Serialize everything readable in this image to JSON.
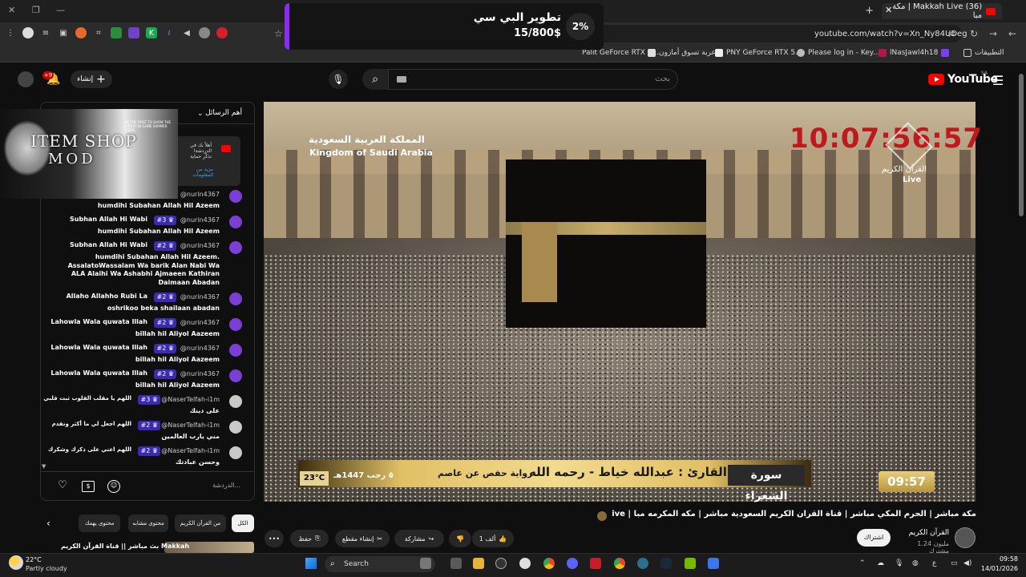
{
  "browser": {
    "tab_title": "(36) ‏Makkah Live | مكة مبا",
    "url": "youtube.com/watch?v=Xn_Ny84UDeg",
    "bookmarks": [
      "Palit GeForce RTX 5...",
      "عربة تسوق أمازون",
      "PNY GeForce RTX 5...",
      "Please log in - Key...",
      "lNasJawl4h18",
      "التطبيقات"
    ]
  },
  "overlay": {
    "percent": "2%",
    "title": "تطوير البي سي",
    "amount": "15/800$"
  },
  "header": {
    "logo_text": "YouTube",
    "country": "SA",
    "search_placeholder": "بحث",
    "create_label": "إنشاء",
    "notif_count": "+9"
  },
  "video": {
    "country_ar": "المملكة العربية السعودية",
    "country_en": "Kingdom of Saudi Arabia",
    "clock": "10:07:56:57",
    "channel_ar": "القرآن الكريم",
    "channel_live": "Live",
    "temp": "23°C",
    "date": "٥ رجب 1447هـ",
    "riwaya": "رواية حفص عن عاصم",
    "qari": "القارئ : عبدالله خياط - رحمه الله",
    "surah": "سورة الشعراء",
    "time": "09:57"
  },
  "details": {
    "title": "مكة مباشر | الحرم المكي مباشر | قناة القران الكريم السعودية مباشر | مكه المكرمه مبا | Makkah Live",
    "channel_name": "القرآن الكريم",
    "channel_subs": "1.24 مليون مشترك",
    "subscribe": "اشتراك",
    "like_count": "1 ألف",
    "share": "مشاركة",
    "clip": "إنشاء مقطع",
    "save": "حفظ",
    "more": "•••"
  },
  "chat": {
    "mode": "أهم الرسائل",
    "pinned_text": "أهلاً بك في الدردشة! تذكّر حماية",
    "pinned_more": "مزيد من المعلومات",
    "input_placeholder": "الدردشة...",
    "overlay_l1": "ITEM SHOP",
    "overlay_l2": "MOD",
    "overlay_small": "BE THE FIRST TO SHOW THE LATEST IN-GAME SUMMER ITEMS",
    "messages": [
      {
        "user": "@nurin4367",
        "badge": "",
        "pre": "",
        "text": "humdihi Subahan Allah Hil Azeem"
      },
      {
        "user": "@nurin4367",
        "badge": "#3",
        "pre": "Subhan Allah Hi Wabi",
        "text": "humdihi Subahan Allah Hil Azeem"
      },
      {
        "user": "@nurin4367",
        "badge": "#2",
        "pre": "Subhan Allah Hi Wabi",
        "text": "humdihi Subahan Allah Hil Azeem. AssalatoWassalam Wa barik Alan Nabi Wa ALA Alaihi Wa Ashabhi Ajmaeen Kathiran Daimaan Abadan"
      },
      {
        "user": "@nurin4367",
        "badge": "#2",
        "pre": "Allaho Allahho Rubi La",
        "text": "oshrikoo beka shailaan abadan"
      },
      {
        "user": "@nurin4367",
        "badge": "#2",
        "pre": "Lahowla Wala quwata Illah",
        "text": "billah hil Aliyol Aazeem"
      },
      {
        "user": "@nurin4367",
        "badge": "#2",
        "pre": "Lahowla Wala quwata Illah",
        "text": "billah hil Aliyol Aazeem"
      },
      {
        "user": "@nurin4367",
        "badge": "#2",
        "pre": "Lahowla Wala quwata Illah",
        "text": "billah hil Aliyol Aazeem"
      },
      {
        "user": "@NaserTelfah-i1m",
        "badge": "#3",
        "pre": "اللهم يا مقلب القلوب ثبت قلبي",
        "text": "على دينك"
      },
      {
        "user": "@NaserTelfah-i1m",
        "badge": "#2",
        "pre": "اللهم اجعل لي ما أكثر وتقدم",
        "text": "مني يارب العالمين"
      },
      {
        "user": "@NaserTelfah-i1m",
        "badge": "#2",
        "pre": "اللهم اعني على ذكرك وشكرك",
        "text": "وحسن عبادتك"
      }
    ]
  },
  "chips": [
    "الكل",
    "من القرآن الكريم",
    "محتوى مشابه",
    "محتوى يهمك"
  ],
  "related": {
    "title": "بث مباشر || قناة القرآن الكريم Makkah"
  },
  "taskbar": {
    "temp": "22°C",
    "weather": "Partly cloudy",
    "search": "Search",
    "time": "09:58",
    "date": "14/01/2026",
    "lang": "ع"
  }
}
